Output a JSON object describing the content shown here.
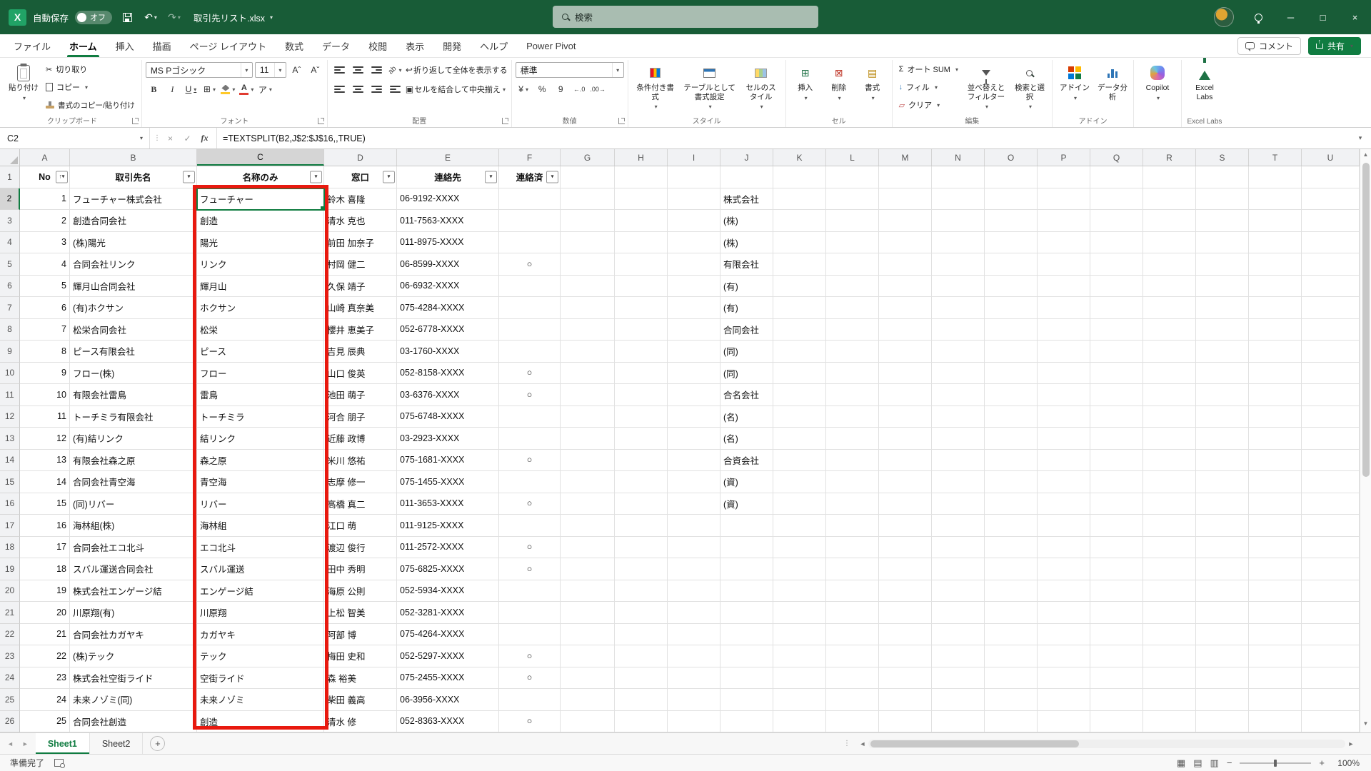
{
  "colors": {
    "title_green": "#185C37",
    "accent_green": "#107C41",
    "annotation_red": "#E8190F"
  },
  "icons": {
    "caret": "▾",
    "sort_up": "↑",
    "minimize": "─",
    "maximize": "□",
    "close": "×",
    "undo": "↶",
    "redo": "↷",
    "cancel": "×",
    "check": "✓",
    "fx": "fx",
    "cut": "✂",
    "bold": "B",
    "italic": "I",
    "underline": "U",
    "borders": "⊞",
    "phonetic": "ア",
    "font_inc": "Aˆ",
    "font_dec": "Aˇ",
    "orientation": "ab",
    "wrap": "↩",
    "merge": "▣",
    "currency": "¥",
    "percent": "%",
    "comma": "9",
    "dec_inc": "←.0",
    "dec_dec": ".00→",
    "sigma": "Σ",
    "fill_arrow": "↓",
    "clear": "▱",
    "insert": "⊞",
    "delete": "⊠",
    "format": "▤",
    "up": "▲",
    "down": "▼",
    "left": "◄",
    "right": "►",
    "dots": "⋮",
    "plus": "+",
    "view_normal": "▦",
    "view_layout": "▤",
    "view_break": "▥",
    "zoom_minus": "−",
    "zoom_plus": "+"
  },
  "title_bar": {
    "app_label": "自動保存",
    "autosave_state": "オフ",
    "filename": "取引先リスト.xlsx",
    "search_placeholder": "検索"
  },
  "tabs": [
    {
      "label": "ファイル",
      "active": false
    },
    {
      "label": "ホーム",
      "active": true
    },
    {
      "label": "挿入",
      "active": false
    },
    {
      "label": "描画",
      "active": false
    },
    {
      "label": "ページ レイアウト",
      "active": false
    },
    {
      "label": "数式",
      "active": false
    },
    {
      "label": "データ",
      "active": false
    },
    {
      "label": "校閲",
      "active": false
    },
    {
      "label": "表示",
      "active": false
    },
    {
      "label": "開発",
      "active": false
    },
    {
      "label": "ヘルプ",
      "active": false
    },
    {
      "label": "Power Pivot",
      "active": false
    }
  ],
  "tab_actions": {
    "comments": "コメント",
    "share": "共有"
  },
  "ribbon": {
    "clipboard": {
      "label": "クリップボード",
      "paste": "貼り付け",
      "cut": "切り取り",
      "copy": "コピー",
      "format_painter": "書式のコピー/貼り付け"
    },
    "font": {
      "label": "フォント",
      "name": "MS Pゴシック",
      "size": "11"
    },
    "alignment": {
      "label": "配置",
      "wrap": "折り返して全体を表示する",
      "merge": "セルを結合して中央揃え"
    },
    "number": {
      "label": "数値",
      "format": "標準"
    },
    "styles": {
      "label": "スタイル",
      "conditional": "条件付き書式",
      "as_table": "テーブルとして書式設定",
      "cell_styles": "セルのスタイル"
    },
    "cells": {
      "label": "セル",
      "insert": "挿入",
      "delete": "削除",
      "format": "書式"
    },
    "editing": {
      "label": "編集",
      "autosum": "オート SUM",
      "fill": "フィル",
      "clear": "クリア",
      "sort": "並べ替えとフィルター",
      "find": "検索と選択"
    },
    "addins": {
      "label": "アドイン",
      "addins": "アドイン",
      "analyze": "データ分析"
    },
    "copilot": {
      "label": "Copilot"
    },
    "excel_labs": {
      "label": "Excel Labs",
      "button": "Excel Labs"
    }
  },
  "formula_bar": {
    "name_box": "C2",
    "formula": "=TEXTSPLIT(B2,J$2:$J$16,,TRUE)"
  },
  "sheet": {
    "columns": [
      "A",
      "B",
      "C",
      "D",
      "E",
      "F",
      "G",
      "H",
      "I",
      "J",
      "K",
      "L",
      "M",
      "N",
      "O",
      "P",
      "Q",
      "R",
      "S",
      "T",
      "U"
    ],
    "active_cell": "C2",
    "table_headers": [
      {
        "col": "A",
        "label": "No",
        "sorted": true
      },
      {
        "col": "B",
        "label": "取引先名"
      },
      {
        "col": "C",
        "label": "名称のみ"
      },
      {
        "col": "D",
        "label": "窓口"
      },
      {
        "col": "E",
        "label": "連絡先"
      },
      {
        "col": "F",
        "label": "連絡済"
      }
    ],
    "rows": [
      {
        "no": "1",
        "company": "フューチャー株式会社",
        "name": "フューチャー",
        "person": "鈴木 喜隆",
        "phone": "06-9192-XXXX",
        "done": "",
        "type": "株式会社"
      },
      {
        "no": "2",
        "company": "創造合同会社",
        "name": "創造",
        "person": "清水 克也",
        "phone": "011-7563-XXXX",
        "done": "",
        "type": "(株)"
      },
      {
        "no": "3",
        "company": "(株)陽光",
        "name": "陽光",
        "person": "前田 加奈子",
        "phone": "011-8975-XXXX",
        "done": "",
        "type": "(株)"
      },
      {
        "no": "4",
        "company": "合同会社リンク",
        "name": "リンク",
        "person": "村岡 健二",
        "phone": "06-8599-XXXX",
        "done": "○",
        "type": "有限会社"
      },
      {
        "no": "5",
        "company": "輝月山合同会社",
        "name": "輝月山",
        "person": "久保 靖子",
        "phone": "06-6932-XXXX",
        "done": "",
        "type": "(有)"
      },
      {
        "no": "6",
        "company": "(有)ホクサン",
        "name": "ホクサン",
        "person": "山崎 真奈美",
        "phone": "075-4284-XXXX",
        "done": "",
        "type": "(有)"
      },
      {
        "no": "7",
        "company": "松栄合同会社",
        "name": "松栄",
        "person": "櫻井 恵美子",
        "phone": "052-6778-XXXX",
        "done": "",
        "type": "合同会社"
      },
      {
        "no": "8",
        "company": "ピース有限会社",
        "name": "ピース",
        "person": "吉見 辰典",
        "phone": "03-1760-XXXX",
        "done": "",
        "type": "(同)"
      },
      {
        "no": "9",
        "company": "フロー(株)",
        "name": "フロー",
        "person": "山口 俊英",
        "phone": "052-8158-XXXX",
        "done": "○",
        "type": "(同)"
      },
      {
        "no": "10",
        "company": "有限会社雷鳥",
        "name": "雷鳥",
        "person": "池田 萌子",
        "phone": "03-6376-XXXX",
        "done": "○",
        "type": "合名会社"
      },
      {
        "no": "11",
        "company": "トーチミラ有限会社",
        "name": "トーチミラ",
        "person": "河合 朋子",
        "phone": "075-6748-XXXX",
        "done": "",
        "type": "(名)"
      },
      {
        "no": "12",
        "company": "(有)結リンク",
        "name": "結リンク",
        "person": "近藤 政博",
        "phone": "03-2923-XXXX",
        "done": "",
        "type": "(名)"
      },
      {
        "no": "13",
        "company": "有限会社森之原",
        "name": "森之原",
        "person": "米川 悠祐",
        "phone": "075-1681-XXXX",
        "done": "○",
        "type": "合資会社"
      },
      {
        "no": "14",
        "company": "合同会社青空海",
        "name": "青空海",
        "person": "志摩 修一",
        "phone": "075-1455-XXXX",
        "done": "",
        "type": "(資)"
      },
      {
        "no": "15",
        "company": "(同)リバー",
        "name": "リバー",
        "person": "高橋 真二",
        "phone": "011-3653-XXXX",
        "done": "○",
        "type": "(資)"
      },
      {
        "no": "16",
        "company": "海林組(株)",
        "name": "海林組",
        "person": "江口 萌",
        "phone": "011-9125-XXXX",
        "done": "",
        "type": ""
      },
      {
        "no": "17",
        "company": "合同会社エコ北斗",
        "name": "エコ北斗",
        "person": "渡辺 俊行",
        "phone": "011-2572-XXXX",
        "done": "○",
        "type": ""
      },
      {
        "no": "18",
        "company": "スバル運送合同会社",
        "name": "スバル運送",
        "person": "田中 秀明",
        "phone": "075-6825-XXXX",
        "done": "○",
        "type": ""
      },
      {
        "no": "19",
        "company": "株式会社エンゲージ結",
        "name": "エンゲージ結",
        "person": "海原 公則",
        "phone": "052-5934-XXXX",
        "done": "",
        "type": ""
      },
      {
        "no": "20",
        "company": "川原翔(有)",
        "name": "川原翔",
        "person": "上松 智美",
        "phone": "052-3281-XXXX",
        "done": "",
        "type": ""
      },
      {
        "no": "21",
        "company": "合同会社カガヤキ",
        "name": "カガヤキ",
        "person": "阿部 博",
        "phone": "075-4264-XXXX",
        "done": "",
        "type": ""
      },
      {
        "no": "22",
        "company": "(株)テック",
        "name": "テック",
        "person": "梅田 史和",
        "phone": "052-5297-XXXX",
        "done": "○",
        "type": ""
      },
      {
        "no": "23",
        "company": "株式会社空街ライド",
        "name": "空街ライド",
        "person": "森 裕美",
        "phone": "075-2455-XXXX",
        "done": "○",
        "type": ""
      },
      {
        "no": "24",
        "company": "未来ノゾミ(同)",
        "name": "未来ノゾミ",
        "person": "柴田 義高",
        "phone": "06-3956-XXXX",
        "done": "",
        "type": ""
      },
      {
        "no": "25",
        "company": "合同会社創造",
        "name": "創造",
        "person": "清水 修",
        "phone": "052-8363-XXXX",
        "done": "○",
        "type": ""
      }
    ]
  },
  "sheet_tabs": {
    "tabs": [
      {
        "label": "Sheet1",
        "active": true
      },
      {
        "label": "Sheet2",
        "active": false
      }
    ]
  },
  "status_bar": {
    "ready": "準備完了",
    "zoom": "100%"
  }
}
